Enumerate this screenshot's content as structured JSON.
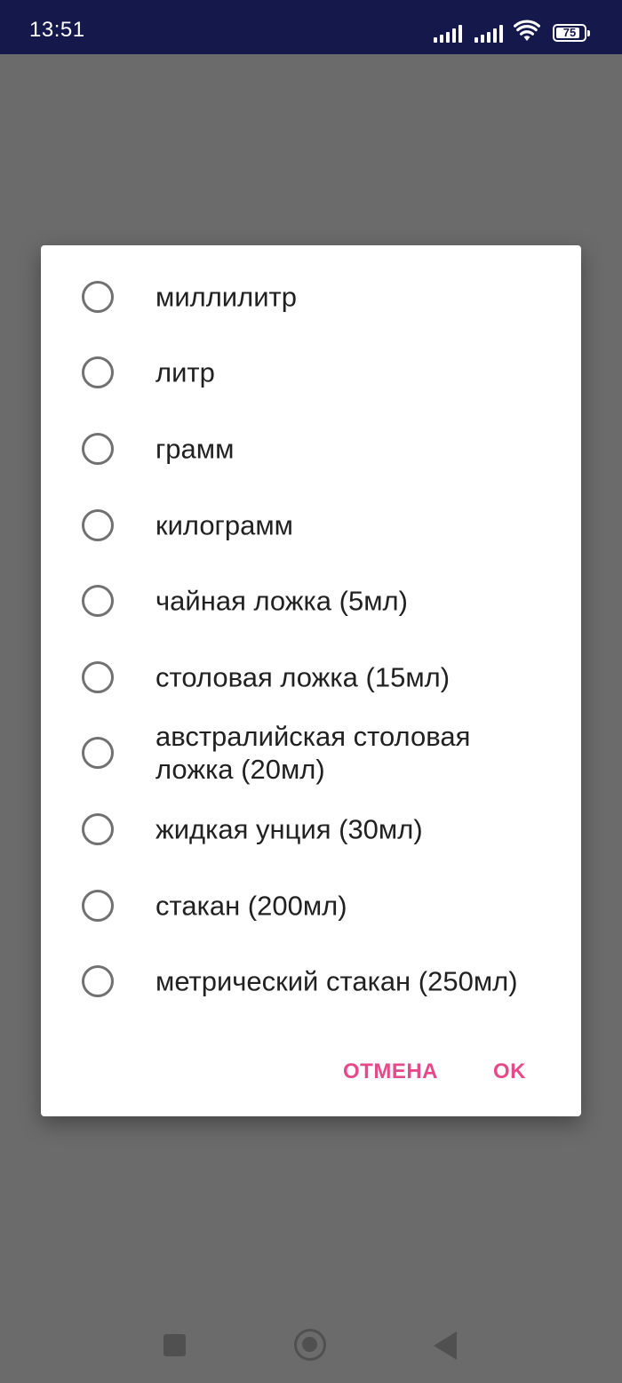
{
  "status_bar": {
    "time": "13:51",
    "battery_level": "75",
    "icons": [
      "signal-icon",
      "signal-icon",
      "wifi-icon",
      "battery-icon"
    ]
  },
  "dialog": {
    "options": [
      {
        "label": "миллилитр"
      },
      {
        "label": "литр"
      },
      {
        "label": "грамм"
      },
      {
        "label": "килограмм"
      },
      {
        "label": "чайная ложка (5мл)"
      },
      {
        "label": "столовая ложка (15мл)"
      },
      {
        "label": "австралийская столовая ложка (20мл)"
      },
      {
        "label": "жидкая унция (30мл)"
      },
      {
        "label": "стакан (200мл)"
      },
      {
        "label": "метрический стакан (250мл)"
      }
    ],
    "cancel_label": "ОТМЕНА",
    "ok_label": "OK"
  },
  "colors": {
    "status_bar_bg": "#14184a",
    "scrim": "#6b6b6b",
    "accent": "#e64a8a",
    "radio_outline": "#717171",
    "text": "#212121"
  },
  "nav_bar": {
    "icons": [
      "recents-square-icon",
      "home-circle-icon",
      "back-triangle-icon"
    ]
  }
}
